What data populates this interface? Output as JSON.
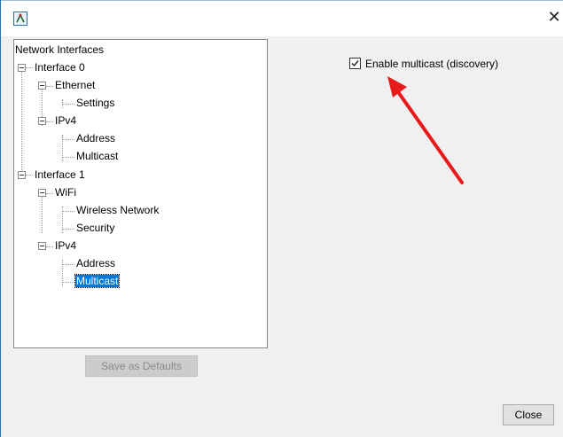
{
  "window": {
    "close_glyph": "✕",
    "app_icon": "app-icon"
  },
  "tree": {
    "root": "Network Interfaces",
    "interface0": {
      "label": "Interface 0",
      "ethernet": {
        "label": "Ethernet",
        "settings": "Settings"
      },
      "ipv4": {
        "label": "IPv4",
        "address": "Address",
        "multicast": "Multicast"
      }
    },
    "interface1": {
      "label": "Interface 1",
      "wifi": {
        "label": "WiFi",
        "wireless_network": "Wireless Network",
        "security": "Security"
      },
      "ipv4": {
        "label": "IPv4",
        "address": "Address",
        "multicast": "Multicast"
      }
    },
    "selected": "Interface 1 / IPv4 / Multicast"
  },
  "buttons": {
    "save_defaults": "Save as Defaults",
    "close": "Close"
  },
  "multicast": {
    "enable_label": "Enable multicast (discovery)",
    "enabled": true
  },
  "colors": {
    "selection": "#0078d7",
    "annotation_arrow": "#e8191a",
    "window_border": "#1e73be"
  }
}
